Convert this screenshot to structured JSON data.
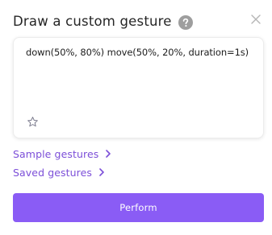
{
  "dialog": {
    "title": "Draw a custom gesture",
    "help_icon": "question-circle-icon",
    "close_icon": "close-x-icon"
  },
  "editor": {
    "code": "down(50%, 80%) move(50%, 20%, duration=1s)",
    "favorite_icon": "star-outline-icon"
  },
  "links": {
    "sample_gestures": "Sample gestures",
    "saved_gestures": "Saved gestures",
    "chevron_icon": "chevron-right-icon"
  },
  "actions": {
    "perform_label": "Perform"
  },
  "colors": {
    "accent": "#8a5cf5",
    "link": "#7c4fd8",
    "help_icon": "#9e9e9e",
    "close_icon": "#b5b5b5",
    "star_icon": "#7a7a8c"
  }
}
